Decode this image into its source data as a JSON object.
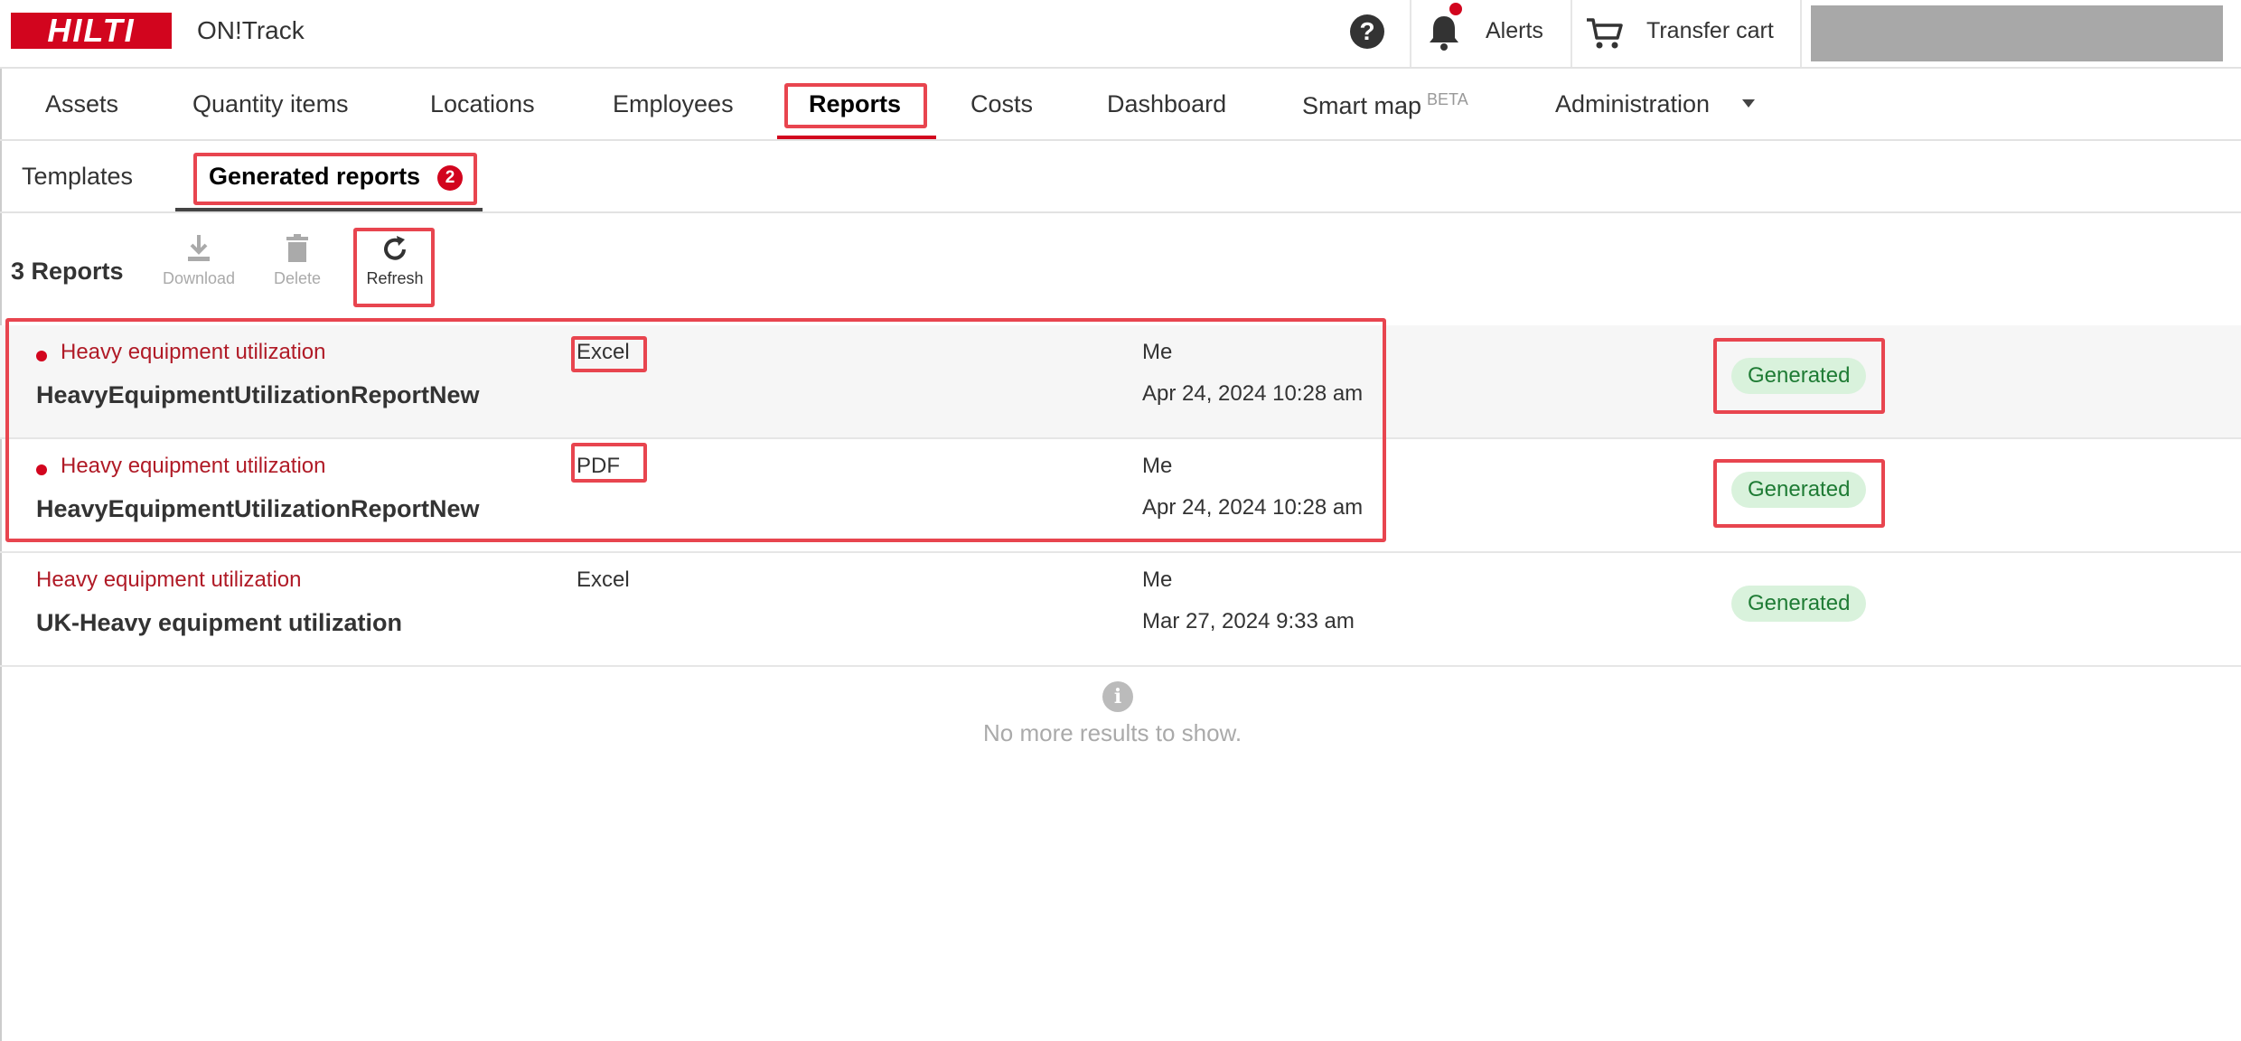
{
  "header": {
    "logo_text": "HILTI",
    "app_title": "ON!Track",
    "help_icon": "question-circle-icon",
    "alerts_label": "Alerts",
    "transfer_cart_label": "Transfer cart"
  },
  "main_nav": {
    "items": [
      {
        "label": "Assets"
      },
      {
        "label": "Quantity items"
      },
      {
        "label": "Locations"
      },
      {
        "label": "Employees"
      },
      {
        "label": "Reports"
      },
      {
        "label": "Costs"
      },
      {
        "label": "Dashboard"
      },
      {
        "label": "Smart map",
        "badge": "BETA"
      },
      {
        "label": "Administration"
      }
    ],
    "active": "Reports"
  },
  "sub_nav": {
    "templates_label": "Templates",
    "generated_label": "Generated reports",
    "generated_badge": "2"
  },
  "toolbar": {
    "count_label": "3 Reports",
    "download_label": "Download",
    "delete_label": "Delete",
    "refresh_label": "Refresh"
  },
  "reports": [
    {
      "template": "Heavy equipment utilization",
      "name": "HeavyEquipmentUtilizationReportNew",
      "format": "Excel",
      "owner": "Me",
      "date": "Apr 24, 2024 10:28 am",
      "status": "Generated",
      "unread": true
    },
    {
      "template": "Heavy equipment utilization",
      "name": "HeavyEquipmentUtilizationReportNew",
      "format": "PDF",
      "owner": "Me",
      "date": "Apr 24, 2024 10:28 am",
      "status": "Generated",
      "unread": true
    },
    {
      "template": "Heavy equipment utilization",
      "name": "UK-Heavy equipment utilization",
      "format": "Excel",
      "owner": "Me",
      "date": "Mar 27, 2024 9:33 am",
      "status": "Generated",
      "unread": false
    }
  ],
  "footer": {
    "no_more_text": "No more results to show."
  },
  "colors": {
    "brand_red": "#d2051e",
    "status_green_bg": "#d9f2dc",
    "status_green_text": "#1e7b34",
    "highlight": "#e8454f"
  }
}
